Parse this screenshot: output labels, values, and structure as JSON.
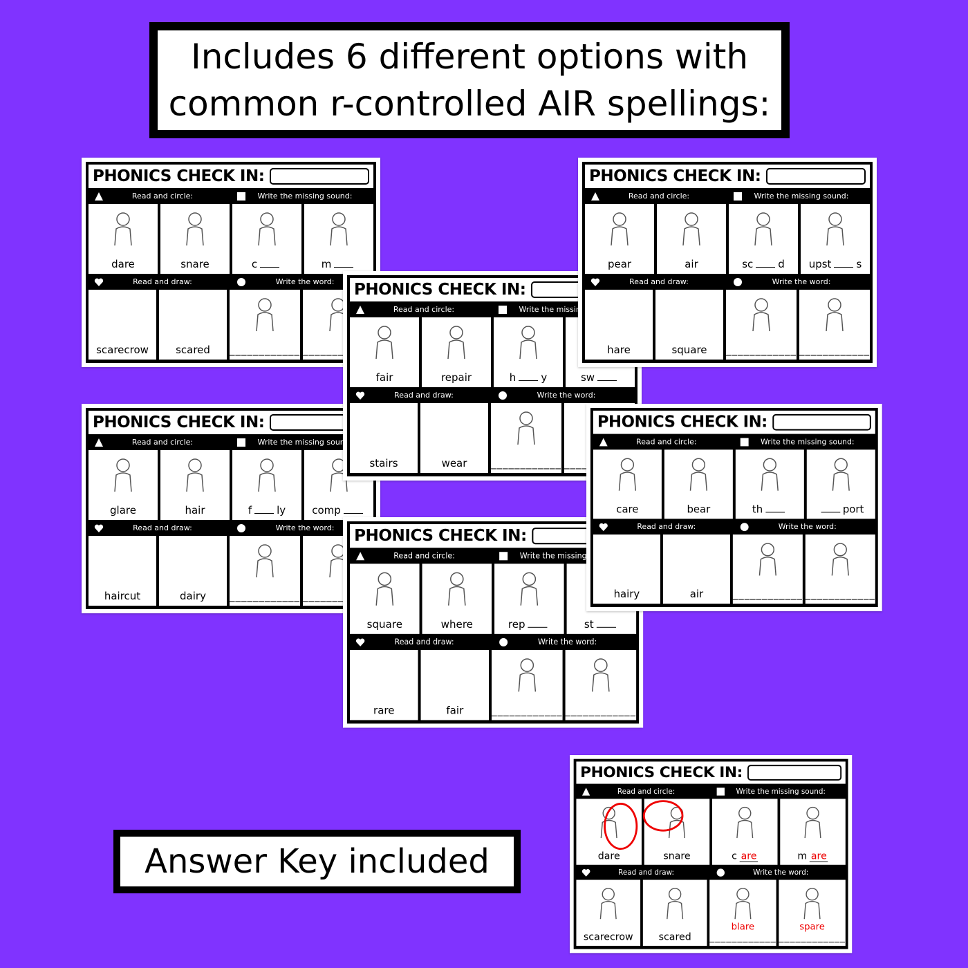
{
  "headline": {
    "line1": "Includes 6 different options with",
    "line2": "common r-controlled AIR spellings:"
  },
  "answer_banner": "Answer Key included",
  "colors": {
    "background": "#8033ff",
    "answer_red": "#e00000"
  },
  "card_title": "PHONICS CHECK IN:",
  "sections": {
    "circle": {
      "label": "Read and circle:",
      "icon": "triangle-icon"
    },
    "missing": {
      "label": "Write the missing sound:",
      "icon": "square-icon"
    },
    "draw": {
      "label": "Read and draw:",
      "icon": "heart-icon"
    },
    "write": {
      "label": "Write the word:",
      "icon": "circle-icon"
    }
  },
  "write_line": "____________",
  "cards": [
    {
      "id": "card-1",
      "circle": [
        "dare",
        "snare"
      ],
      "missing": [
        {
          "pre": "c",
          "post": ""
        },
        {
          "pre": "m",
          "post": ""
        }
      ],
      "draw": [
        "scarecrow",
        "scared"
      ],
      "write": [
        "",
        ""
      ]
    },
    {
      "id": "card-4",
      "circle": [
        "glare",
        "hair"
      ],
      "missing": [
        {
          "pre": "f",
          "post": "ly"
        },
        {
          "pre": "comp",
          "post": ""
        }
      ],
      "draw": [
        "haircut",
        "dairy"
      ],
      "write": [
        "",
        ""
      ]
    },
    {
      "id": "card-3",
      "circle": [
        "fair",
        "repair"
      ],
      "missing": [
        {
          "pre": "h",
          "post": "y"
        },
        {
          "pre": "sw",
          "post": ""
        }
      ],
      "draw": [
        "stairs",
        "wear"
      ],
      "write": [
        "",
        ""
      ]
    },
    {
      "id": "card-6",
      "circle": [
        "square",
        "where"
      ],
      "missing": [
        {
          "pre": "rep",
          "post": ""
        },
        {
          "pre": "st",
          "post": ""
        }
      ],
      "draw": [
        "rare",
        "fair"
      ],
      "write": [
        "",
        ""
      ]
    },
    {
      "id": "card-2",
      "circle": [
        "pear",
        "air"
      ],
      "missing": [
        {
          "pre": "sc",
          "post": "d"
        },
        {
          "pre": "upst",
          "post": "s"
        }
      ],
      "draw": [
        "hare",
        "square"
      ],
      "write": [
        "",
        ""
      ]
    },
    {
      "id": "card-5",
      "circle": [
        "care",
        "bear"
      ],
      "missing": [
        {
          "pre": "th",
          "post": ""
        },
        {
          "pre": "",
          "post": "port"
        }
      ],
      "draw": [
        "hairy",
        "air"
      ],
      "write": [
        "",
        ""
      ]
    },
    {
      "id": "answer-key",
      "answer_key": true,
      "circled": [
        true,
        true
      ],
      "circle": [
        "dare",
        "snare"
      ],
      "missing": [
        {
          "pre": "c",
          "post": "",
          "answer": "are"
        },
        {
          "pre": "m",
          "post": "",
          "answer": "are"
        }
      ],
      "draw": [
        "scarecrow",
        "scared"
      ],
      "write": [
        "blare",
        "spare"
      ]
    }
  ]
}
